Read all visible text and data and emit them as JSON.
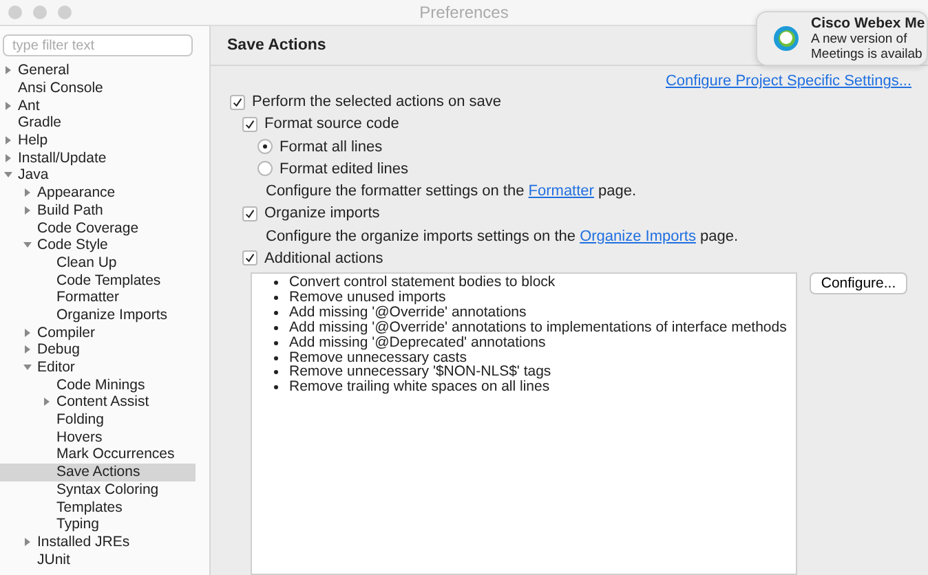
{
  "window": {
    "title": "Preferences"
  },
  "sidebar": {
    "filter": {
      "placeholder": "type filter text"
    },
    "items": [
      {
        "label": "General",
        "expanded": false,
        "selected": false
      },
      {
        "label": "Ansi Console",
        "selected": false
      },
      {
        "label": "Ant",
        "expanded": false,
        "selected": false
      },
      {
        "label": "Gradle",
        "selected": false
      },
      {
        "label": "Help",
        "expanded": false,
        "selected": false
      },
      {
        "label": "Install/Update",
        "expanded": false,
        "selected": false
      },
      {
        "label": "Java",
        "expanded": true,
        "selected": false,
        "children": [
          {
            "label": "Appearance",
            "expanded": false,
            "selected": false
          },
          {
            "label": "Build Path",
            "expanded": false,
            "selected": false
          },
          {
            "label": "Code Coverage",
            "selected": false
          },
          {
            "label": "Code Style",
            "expanded": true,
            "selected": false,
            "children": [
              {
                "label": "Clean Up",
                "selected": false
              },
              {
                "label": "Code Templates",
                "selected": false
              },
              {
                "label": "Formatter",
                "selected": false
              },
              {
                "label": "Organize Imports",
                "selected": false
              }
            ]
          },
          {
            "label": "Compiler",
            "expanded": false,
            "selected": false
          },
          {
            "label": "Debug",
            "expanded": false,
            "selected": false
          },
          {
            "label": "Editor",
            "expanded": true,
            "selected": false,
            "children": [
              {
                "label": "Code Minings",
                "selected": false
              },
              {
                "label": "Content Assist",
                "expanded": false,
                "selected": false
              },
              {
                "label": "Folding",
                "selected": false
              },
              {
                "label": "Hovers",
                "selected": false
              },
              {
                "label": "Mark Occurrences",
                "selected": false
              },
              {
                "label": "Save Actions",
                "selected": true
              },
              {
                "label": "Syntax Coloring",
                "selected": false
              },
              {
                "label": "Templates",
                "selected": false
              },
              {
                "label": "Typing",
                "selected": false
              }
            ]
          },
          {
            "label": "Installed JREs",
            "expanded": false,
            "selected": false
          },
          {
            "label": "JUnit",
            "selected": false
          }
        ]
      }
    ]
  },
  "page": {
    "title": "Save Actions",
    "project_link": "Configure Project Specific Settings...",
    "options": [
      {
        "kind": "master_checkbox",
        "label": "Perform the selected actions on save",
        "checked": true
      },
      {
        "kind": "checkbox",
        "label": "Format source code",
        "checked": true
      },
      {
        "kind": "radio",
        "label": "Format all lines",
        "selected": true
      },
      {
        "kind": "radio",
        "label": "Format edited lines",
        "selected": false
      },
      {
        "kind": "note",
        "before": "Configure the formatter settings on the ",
        "link": "Formatter",
        "after": " page."
      },
      {
        "kind": "checkbox",
        "label": "Organize imports",
        "checked": true
      },
      {
        "kind": "note",
        "before": "Configure the organize imports settings on the ",
        "link": "Organize Imports",
        "after": " page."
      },
      {
        "kind": "checkbox",
        "label": "Additional actions",
        "checked": true
      }
    ],
    "actions": [
      "Convert control statement bodies to block",
      "Remove unused imports",
      "Add missing '@Override' annotations",
      "Add missing '@Override' annotations to implementations of interface methods",
      "Add missing '@Deprecated' annotations",
      "Remove unnecessary casts",
      "Remove unnecessary '$NON-NLS$' tags",
      "Remove trailing white spaces on all lines"
    ],
    "configure_button": "Configure..."
  },
  "notification": {
    "title": "Cisco Webex Me",
    "lines": [
      "A new version of",
      "Meetings is availab"
    ]
  }
}
